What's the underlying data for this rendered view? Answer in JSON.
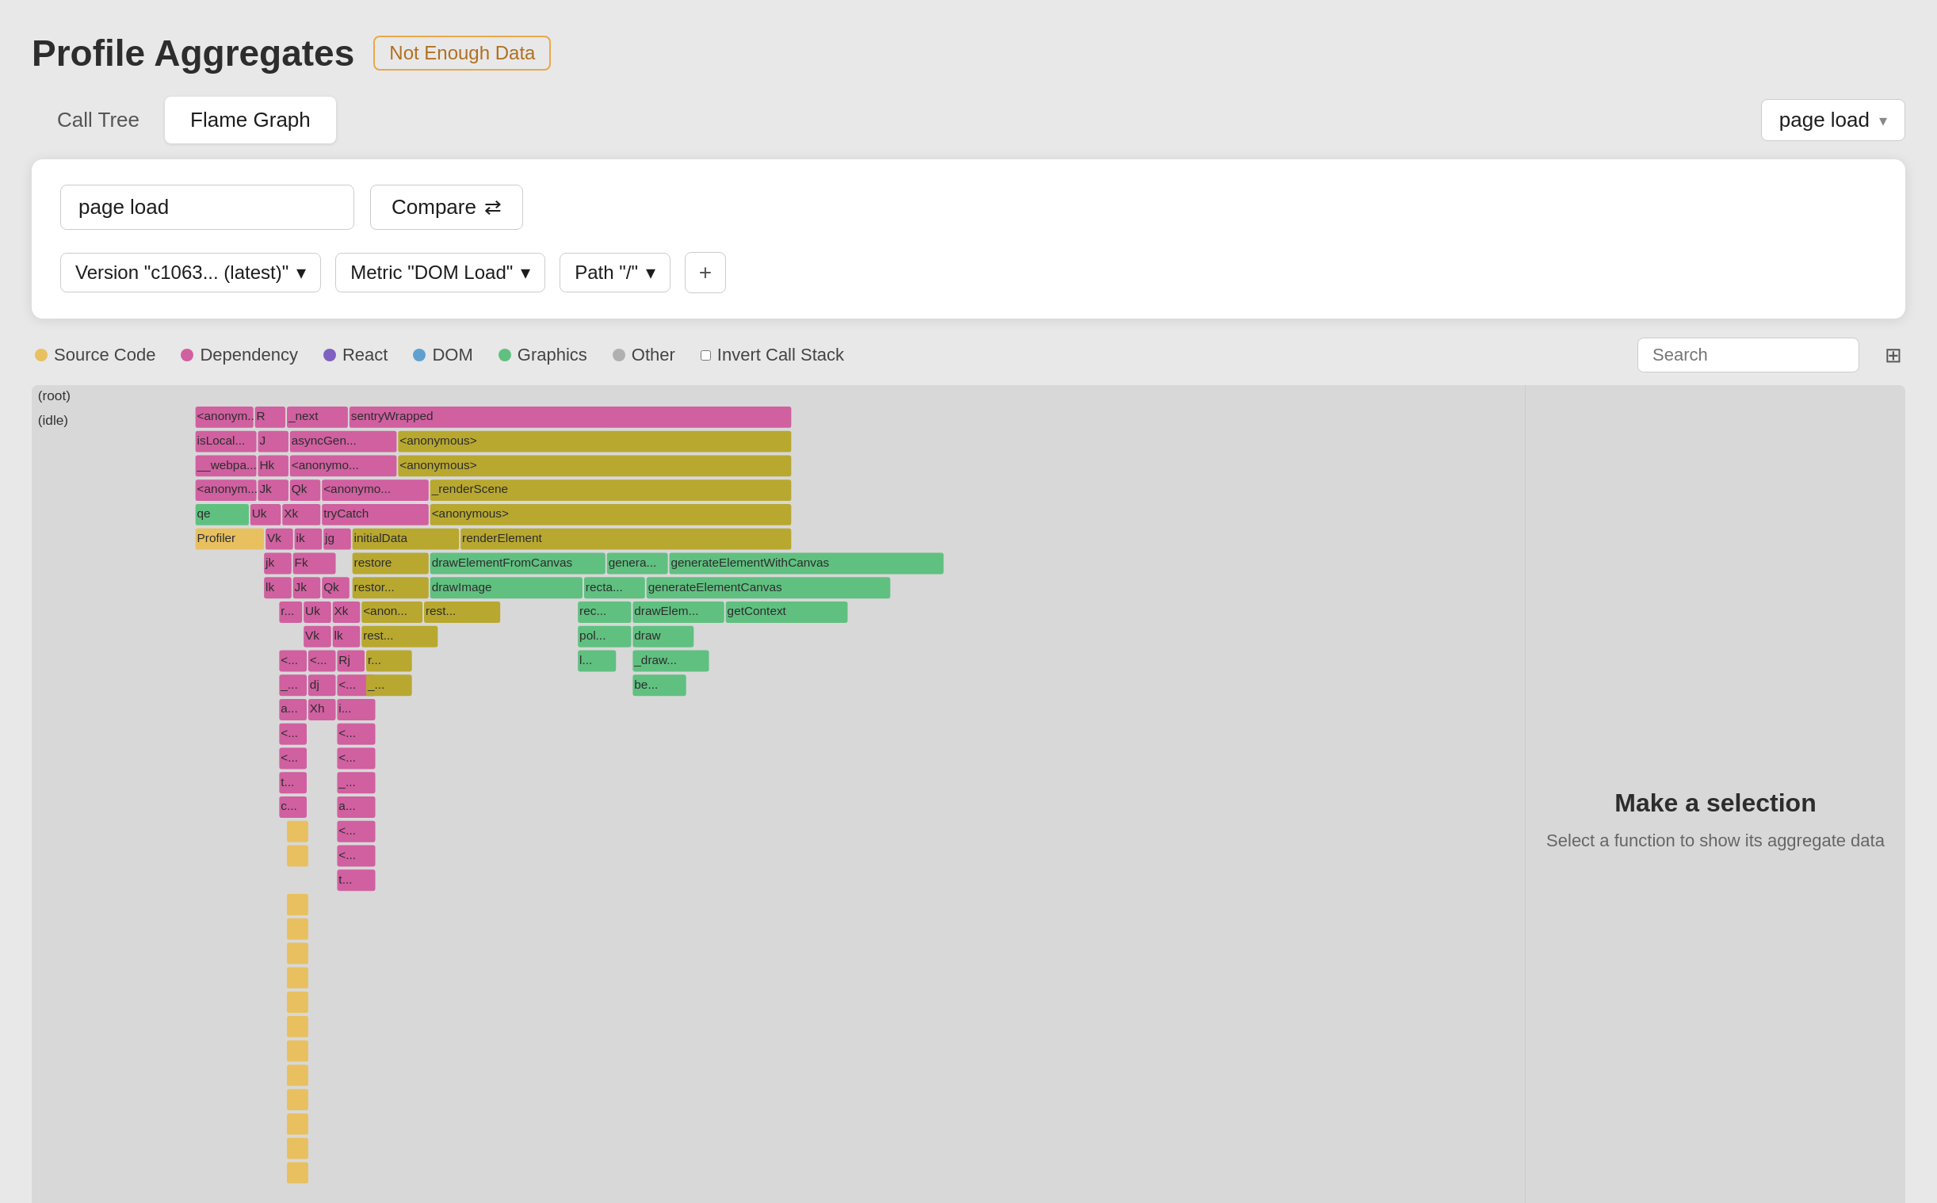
{
  "header": {
    "title": "Profile Aggregates",
    "not_enough_data": "Not Enough Data"
  },
  "tabs": {
    "items": [
      {
        "label": "Call Tree",
        "active": false
      },
      {
        "label": "Flame Graph",
        "active": true
      }
    ]
  },
  "page_load_select": {
    "label": "page load",
    "icon": "chevron-down"
  },
  "filter_card": {
    "input_value": "page load",
    "compare_label": "Compare",
    "compare_icon": "⇄",
    "filters": [
      {
        "label": "Version \"c1063...  (latest)\""
      },
      {
        "label": "Metric \"DOM Load\""
      },
      {
        "label": "Path \"/\""
      }
    ],
    "add_label": "+"
  },
  "legend": {
    "items": [
      {
        "label": "Source Code",
        "color": "#e8c060"
      },
      {
        "label": "Dependency",
        "color": "#d060a0"
      },
      {
        "label": "React",
        "color": "#8060c0"
      },
      {
        "label": "DOM",
        "color": "#60a0d0"
      },
      {
        "label": "Graphics",
        "color": "#60c080"
      },
      {
        "label": "Other",
        "color": "#b0b0b0"
      }
    ],
    "invert_label": "Invert Call Stack",
    "search_placeholder": "Search"
  },
  "selection_panel": {
    "title": "Make a selection",
    "subtitle": "Select a function to show its aggregate data"
  },
  "flame_rows": [
    {
      "label": "(root)",
      "indent": 0
    },
    {
      "label": "(idle)",
      "indent": 1
    }
  ]
}
